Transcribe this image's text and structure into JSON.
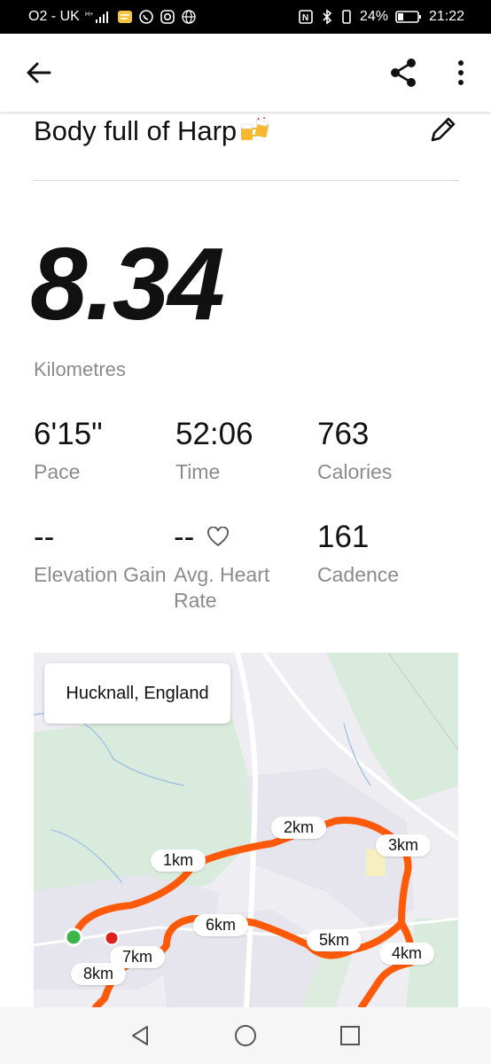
{
  "status_bar": {
    "carrier": "O2 - UK",
    "battery": "24%",
    "time": "21:22"
  },
  "header": {
    "title": "Body full of Harp",
    "title_emoji": "beer-mugs-icon"
  },
  "activity": {
    "distance": "8.34",
    "distance_unit": "Kilometres",
    "stats": [
      {
        "value": "6'15\"",
        "label": "Pace"
      },
      {
        "value": "52:06",
        "label": "Time"
      },
      {
        "value": "763",
        "label": "Calories"
      },
      {
        "value": "--",
        "label": "Elevation Gain"
      },
      {
        "value": "--",
        "label": "Avg. Heart Rate"
      },
      {
        "value": "161",
        "label": "Cadence"
      }
    ]
  },
  "map": {
    "location": "Hucknall, England",
    "route_color": "#ff5a0a",
    "markers": [
      "1km",
      "2km",
      "3km",
      "4km",
      "5km",
      "6km",
      "7km",
      "8km"
    ]
  },
  "colors": {
    "route": "#ff5a0a",
    "start": "#3cb54a",
    "end": "#e0201e"
  }
}
